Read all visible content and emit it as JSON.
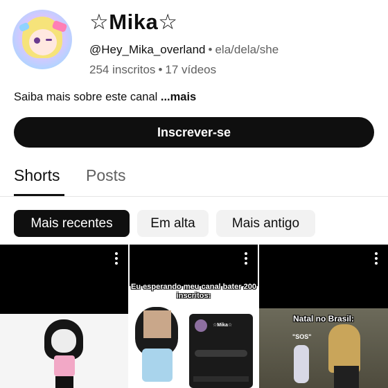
{
  "channel": {
    "name": "☆Mika☆",
    "handle": "@Hey_Mika_overland",
    "separator": "•",
    "pronouns": "ela/dela/she",
    "subscribers": "254 inscritos",
    "videos": "17 vídeos"
  },
  "about": {
    "text": "Saiba mais sobre este canal ",
    "more_label": "...mais"
  },
  "subscribe_label": "Inscrever-se",
  "tabs": [
    {
      "label": "Shorts",
      "active": true
    },
    {
      "label": "Posts",
      "active": false
    }
  ],
  "chips": [
    {
      "label": "Mais recentes",
      "selected": true
    },
    {
      "label": "Em alta",
      "selected": false
    },
    {
      "label": "Mais antigo",
      "selected": false
    }
  ],
  "shorts": [
    {
      "caption": ""
    },
    {
      "caption": "Eu esperando meu canal bater 200 inscritos:",
      "inner_name": "☆Mika☆"
    },
    {
      "caption": "Natal no Brasil:",
      "inner_text": "\"SOS\""
    }
  ],
  "colors": {
    "primary_text": "#0f0f0f",
    "secondary_text": "#606060",
    "button_dark": "#0f0f0f",
    "chip_light": "#f2f2f2"
  },
  "icons": {
    "kebab": "more-vert-icon"
  }
}
